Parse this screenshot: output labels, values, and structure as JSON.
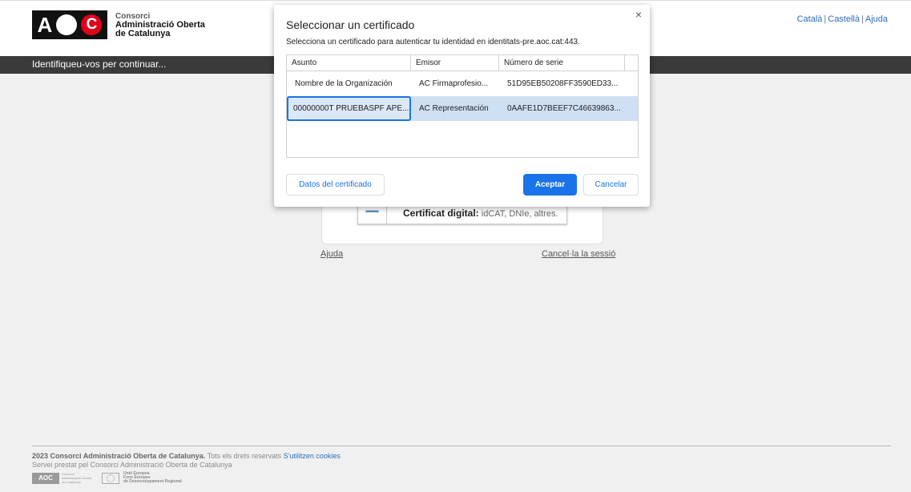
{
  "header": {
    "logo_text": "AOC",
    "org_line1": "Consorci",
    "org_line2": "Administració Oberta",
    "org_line3": "de Catalunya",
    "lang_catala": "Català",
    "lang_castella": "Castellà",
    "help": "Ajuda",
    "separator": "|"
  },
  "bar": {
    "text": "Identifiqueu-vos per continuar..."
  },
  "login": {
    "cert_title": "Certificat digital:",
    "cert_desc": " idCAT, DNIe, altres.",
    "help_link": "Ajuda",
    "cancel_link": "Cancel·la la sessió"
  },
  "dialog": {
    "title": "Seleccionar un certificado",
    "subtitle": "Selecciona un certificado para autenticar tu identidad en identitats-pre.aoc.cat:443.",
    "close": "×",
    "columns": [
      "Asunto",
      "Emisor",
      "Número de serie"
    ],
    "rows": [
      {
        "subject": "Nombre de la Organización",
        "issuer": "AC Firmaprofesio...",
        "serial": "51D95EB50208FF3590ED33..."
      },
      {
        "subject": "00000000T PRUEBASPF APE...",
        "issuer": "AC Representación",
        "serial": "0AAFE1D7BEEF7C46639863..."
      }
    ],
    "details_button": "Datos del certificado",
    "accept_button": "Aceptar",
    "cancel_button": "Cancelar"
  },
  "footer": {
    "copyright": "2023 Consorci Administració Oberta de Catalunya.",
    "rights": " Tots els drets reservats ",
    "cookies": "S'utilitzen cookies",
    "service": "Servei prestat pel Consorci Administració Oberta de Catalunya",
    "aoc_small": "AOC",
    "aoc_small_text": "Consorci Administració Oberta de Catalunya",
    "eu_text1": "Unió Europea",
    "eu_text2": "Fons Europeu",
    "eu_text3": "de Desenvolupament Regional"
  },
  "colors": {
    "accent": "#1a73e8",
    "brand_red": "#e2001a",
    "bar": "#3a3a3a",
    "link": "#2a6ebb"
  }
}
